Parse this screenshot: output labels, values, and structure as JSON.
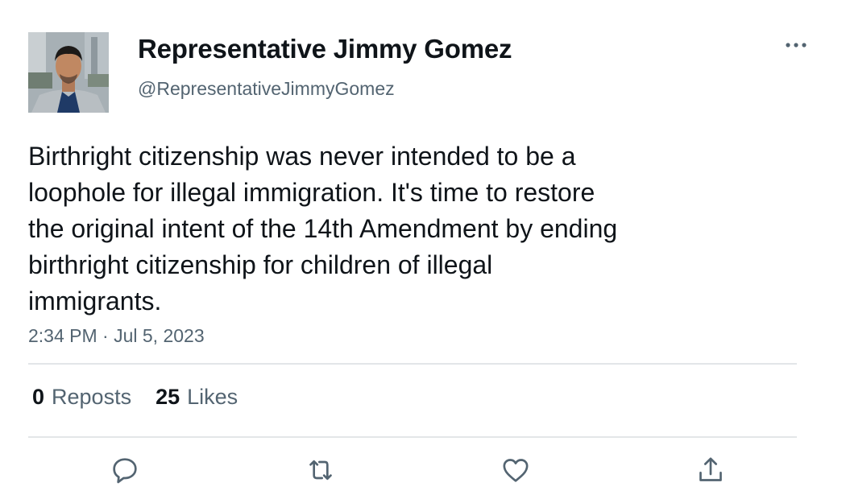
{
  "author": {
    "display_name": "Representative Jimmy Gomez",
    "handle": "@RepresentativeJimmyGomez",
    "avatar_icon": "profile-photo"
  },
  "tweet": {
    "text": "Birthright citizenship was never intended to be a\nloophole for illegal immigration. It's time to restore\nthe original intent of the 14th Amendment by ending\nbirthright citizenship for children of illegal\nimmigrants.",
    "timestamp": "2:34 PM · Jul 5, 2023"
  },
  "stats": {
    "reposts": {
      "count": "0",
      "label": "Reposts"
    },
    "likes": {
      "count": "25",
      "label": "Likes"
    }
  },
  "actions": [
    {
      "name": "reply",
      "icon": "speech-bubble-icon"
    },
    {
      "name": "repost",
      "icon": "repost-arrows-icon"
    },
    {
      "name": "like",
      "icon": "heart-icon"
    },
    {
      "name": "share",
      "icon": "share-upload-icon"
    }
  ],
  "colors": {
    "text_primary": "#0f1419",
    "text_secondary": "#536471",
    "divider": "#e3e6e8",
    "icon": "#536471"
  }
}
